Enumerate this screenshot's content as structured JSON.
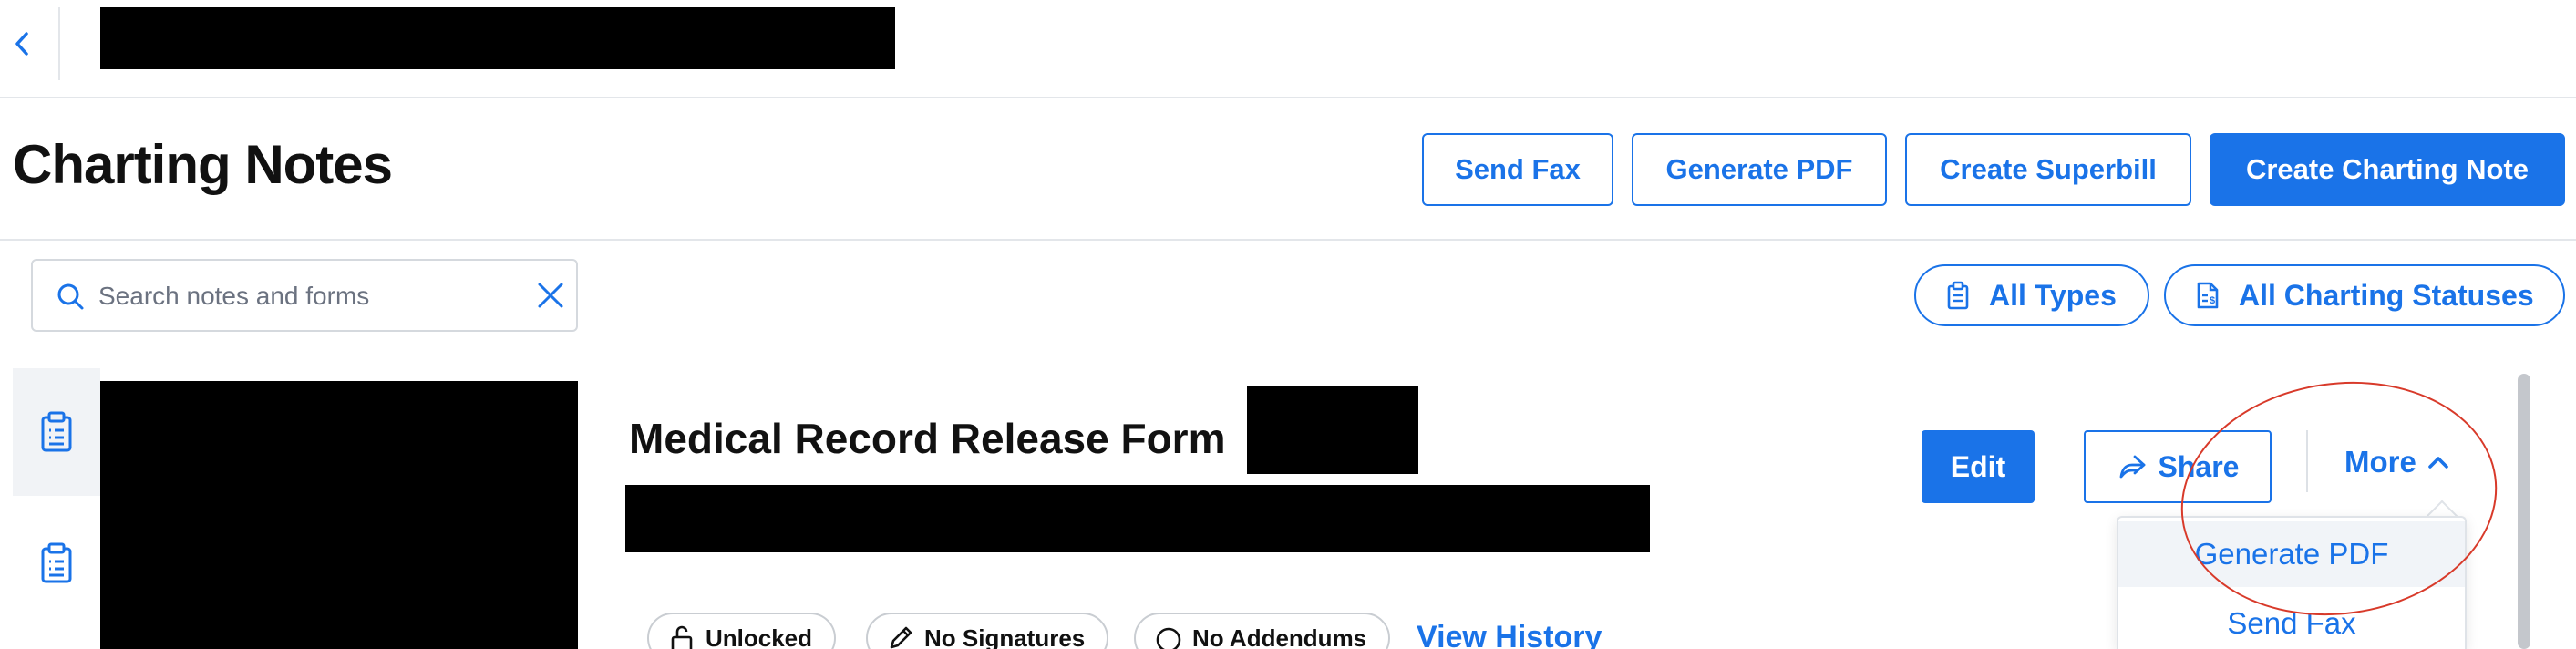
{
  "header": {
    "page_title": "Charting Notes",
    "actions": {
      "send_fax": "Send Fax",
      "generate_pdf": "Generate PDF",
      "create_superbill": "Create Superbill",
      "create_charting_note": "Create Charting Note"
    }
  },
  "search": {
    "placeholder": "Search notes and forms",
    "value": ""
  },
  "filters": {
    "types": "All Types",
    "statuses": "All Charting Statuses"
  },
  "note": {
    "title": "Medical Record Release Form",
    "badges": {
      "lock": "Unlocked",
      "signatures": "No Signatures",
      "addendums": "No Addendums"
    },
    "view_history": "View History",
    "actions": {
      "edit": "Edit",
      "share": "Share",
      "more": "More"
    },
    "more_menu": [
      "Generate PDF",
      "Send Fax"
    ]
  },
  "icons": {
    "back": "chevron-left-icon",
    "search": "search-icon",
    "clear": "close-icon",
    "types": "clipboard-icon",
    "statuses": "document-dollar-icon",
    "lock": "unlock-icon",
    "signatures": "pen-icon",
    "addendums": "circle-icon",
    "share": "share-arrow-icon",
    "more": "chevron-up-icon"
  },
  "colors": {
    "accent": "#1a73e8",
    "annotation": "#d83a2a",
    "border": "#e3e6ea"
  }
}
